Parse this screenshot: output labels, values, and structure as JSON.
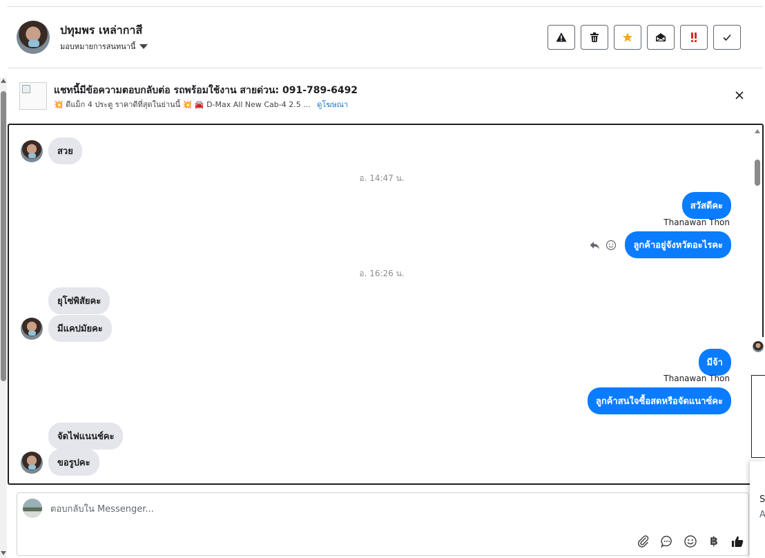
{
  "header": {
    "contact_name": "ปทุมพร เหล่ากาสี",
    "assign_label": "มอบหมายการสนทนานี้",
    "actions": [
      {
        "name": "report-spam-button",
        "icon": "warning-icon"
      },
      {
        "name": "delete-button",
        "icon": "trash-icon"
      },
      {
        "name": "star-button",
        "icon": "star-icon"
      },
      {
        "name": "mark-unread-button",
        "icon": "envelope-open-icon"
      },
      {
        "name": "follow-up-button",
        "icon": "double-exclamation-icon"
      },
      {
        "name": "mark-done-button",
        "icon": "check-icon"
      }
    ]
  },
  "banner": {
    "title": "แชทนี้มีข้อความตอบกลับต่อ รถพร้อมใช้งาน สายด่วน: 091-789-6492",
    "description": "💥 ดีแม็ก 4 ประตู ราคาดีที่สุดในย่านนี้ 💥 🚘 D-Max All New Cab-4 2.5 ...",
    "link": "ดูโฆษณา"
  },
  "messages": {
    "m1": "สวย",
    "t1": "อ. 14:47 น.",
    "m2": "สวัสดีคะ",
    "sender1": "Thanawan Thon",
    "m3": "ลูกค้าอยู่จังหวัดอะไรคะ",
    "t2": "อ. 16:26 น.",
    "m4": "ยุโซ่พิสัยคะ",
    "m5": "มีแคปมัยคะ",
    "m6": "มีจ้า",
    "sender2": "Thanawan Thon",
    "m7": "ลูกค้าสนใจซื้อสดหรือจัดแนาซ์คะ",
    "m8": "จัดไฟแนนช์คะ",
    "m9": "ขอรูปคะ"
  },
  "composer": {
    "placeholder": "ตอบกลับใน Messenger...",
    "currency_symbol": "฿"
  },
  "edge": {
    "t1": "S",
    "t2": "A"
  },
  "colors": {
    "outgoing_bubble": "#0a7cff",
    "incoming_bubble": "#e4e6eb",
    "star": "#f5a623",
    "follow_up": "#e02424"
  }
}
